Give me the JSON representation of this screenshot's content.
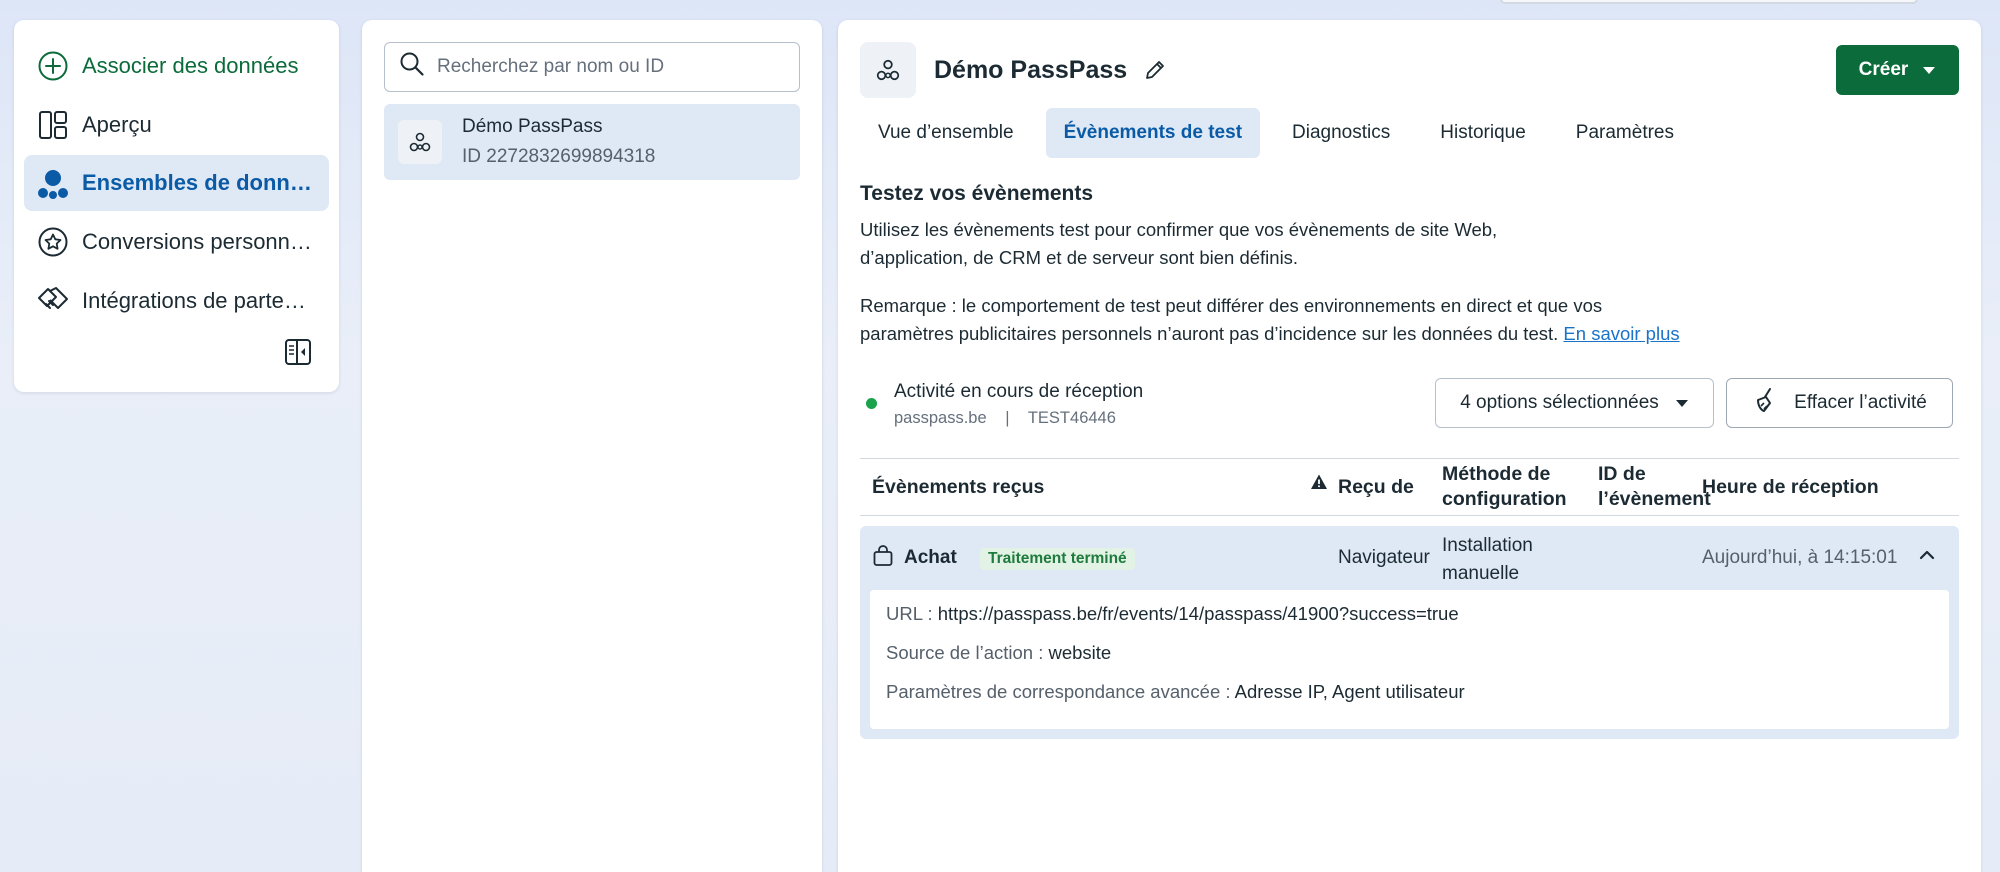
{
  "nav": {
    "items": [
      {
        "label": "Associer des données",
        "icon": "plus-circle-icon"
      },
      {
        "label": "Aperçu",
        "icon": "layout-icon"
      },
      {
        "label": "Ensembles de données",
        "icon": "dataset-icon"
      },
      {
        "label": "Conversions personnalisées",
        "icon": "star-badge-icon"
      },
      {
        "label": "Intégrations de partenaires",
        "icon": "handshake-icon"
      }
    ],
    "active_index": 2
  },
  "list": {
    "search_placeholder": "Recherchez par nom ou ID",
    "items": [
      {
        "name": "Démo PassPass",
        "id": "ID 2272832699894318"
      }
    ]
  },
  "detail": {
    "title": "Démo PassPass",
    "create_label": "Créer",
    "tabs": [
      "Vue d’ensemble",
      "Évènements de test",
      "Diagnostics",
      "Historique",
      "Paramètres"
    ],
    "active_tab": 1,
    "section_title": "Testez vos évènements",
    "intro_line1": "Utilisez les évènements test pour confirmer que vos évènements de site Web,",
    "intro_line2": "d’application, de CRM et de serveur sont bien définis.",
    "note_text": "Remarque : le comportement de test peut différer des environnements en direct et que vos paramètres publicitaires personnels n’auront pas d’incidence sur les données du test.",
    "note_link": "En savoir plus",
    "activity": {
      "title": "Activité en cours de réception",
      "domain": "passpass.be",
      "separator": "|",
      "test_code": "TEST46446"
    },
    "filter_label": "4 options sélectionnées",
    "clear_label": "Effacer l’activité",
    "table": {
      "headers": {
        "events": "Évènements reçus",
        "received_from": "Reçu de",
        "method": "Méthode de configuration",
        "event_id": "ID de l’évènement",
        "time": "Heure de réception"
      },
      "rows": [
        {
          "event": "Achat",
          "status": "Traitement terminé",
          "received_from": "Navigateur",
          "method": "Installation manuelle",
          "event_id": "",
          "time": "Aujourd’hui, à 14:15:01",
          "details": [
            {
              "key": "URL : ",
              "value": "https://passpass.be/fr/events/14/passpass/41900?success=true"
            },
            {
              "key": "Source de l’action : ",
              "value": "website"
            },
            {
              "key": "Paramètres de correspondance avancée : ",
              "value": "Adresse IP, Agent utilisateur"
            }
          ]
        }
      ]
    }
  },
  "colors": {
    "primary_green": "#0b6b3a",
    "active_blue": "#0a5aa6",
    "active_bg": "#dfe9f5",
    "status_dot": "#1aa34a",
    "link": "#1a73c9"
  }
}
